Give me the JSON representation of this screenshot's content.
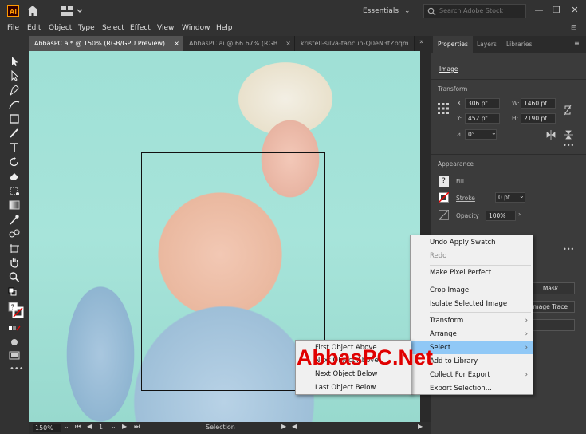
{
  "app": {
    "logo_text": "Ai",
    "workspace": "Essentials"
  },
  "search": {
    "placeholder": "Search Adobe Stock"
  },
  "window_controls": {
    "minimize": "—",
    "restore": "❐",
    "close": "✕"
  },
  "menubar": [
    "File",
    "Edit",
    "Object",
    "Type",
    "Select",
    "Effect",
    "View",
    "Window",
    "Help"
  ],
  "tabs": [
    {
      "label": "AbbasPC.ai* @ 150% (RGB/GPU Preview)",
      "close": "×"
    },
    {
      "label": "AbbasPC.ai @ 66.67% (RGB...",
      "close": "×"
    },
    {
      "label": "kristell-silva-tancun-Q0eN3tZbqm",
      "close": ""
    }
  ],
  "status": {
    "zoom": "150%",
    "page": "1",
    "tool": "Selection"
  },
  "panel": {
    "tabs": [
      "Properties",
      "Layers",
      "Libraries"
    ],
    "object_type": "Image",
    "transform": {
      "title": "Transform",
      "x_label": "X:",
      "x": "306 pt",
      "y_label": "Y:",
      "y": "452 pt",
      "w_label": "W:",
      "w": "1460 pt",
      "h_label": "H:",
      "h": "2190 pt",
      "angle_label": "⊿:",
      "angle": "0°"
    },
    "appearance": {
      "title": "Appearance",
      "fill_label": "Fill",
      "stroke_label": "Stroke",
      "stroke_value": "0 pt",
      "opacity_label": "Opacity",
      "opacity_value": "100%"
    },
    "buttons": {
      "mask": "Mask",
      "image_trace": "Image Trace"
    }
  },
  "context_menu": {
    "items": [
      {
        "label": "Undo Apply Swatch",
        "disabled": false
      },
      {
        "label": "Redo",
        "disabled": true
      },
      {
        "label": "Make Pixel Perfect",
        "disabled": false
      },
      {
        "label": "Crop Image",
        "disabled": false
      },
      {
        "label": "Isolate Selected Image",
        "disabled": false
      },
      {
        "label": "Transform",
        "disabled": false
      },
      {
        "label": "Arrange",
        "disabled": false
      },
      {
        "label": "Select",
        "disabled": false
      },
      {
        "label": "Add to Library",
        "disabled": false
      },
      {
        "label": "Collect For Export",
        "disabled": false
      },
      {
        "label": "Export Selection...",
        "disabled": false
      }
    ]
  },
  "submenu": {
    "items": [
      "First Object Above",
      "Next Object Above",
      "Next Object Below",
      "Last Object Below"
    ]
  },
  "watermark": "AbbasPC.Net"
}
